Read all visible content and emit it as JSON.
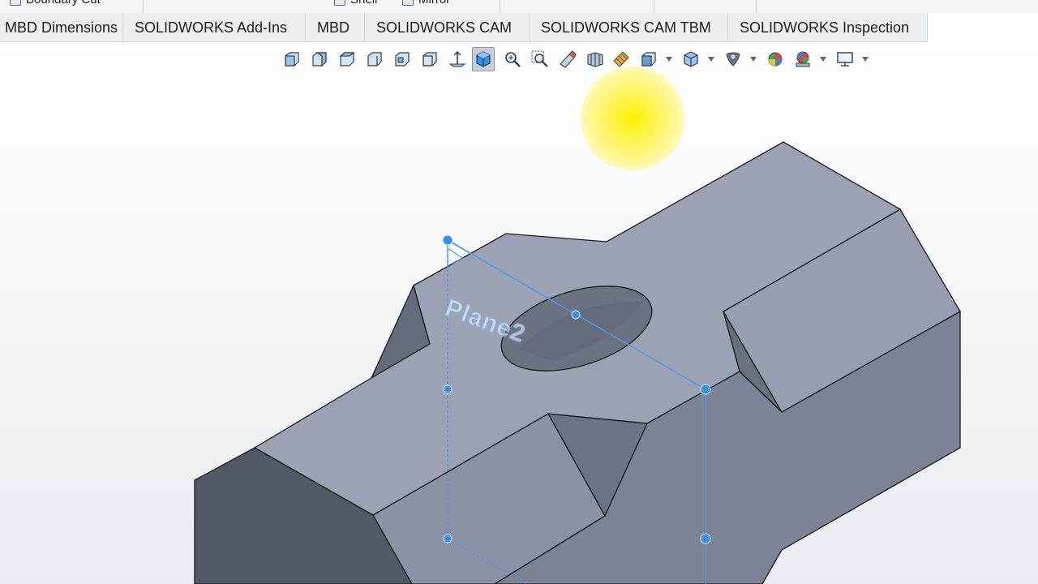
{
  "ribbon": {
    "items": [
      "Boundary Cut",
      "Shell",
      "Mirror"
    ]
  },
  "tabs": [
    {
      "label": "MBD Dimensions"
    },
    {
      "label": "SOLIDWORKS Add-Ins"
    },
    {
      "label": "MBD"
    },
    {
      "label": "SOLIDWORKS CAM"
    },
    {
      "label": "SOLIDWORKS CAM TBM"
    },
    {
      "label": "SOLIDWORKS Inspection"
    }
  ],
  "viewport": {
    "plane_label": "Plane2"
  },
  "colors": {
    "accent": "#3b8fe0",
    "part_top": "#9aa0b1",
    "part_side": "#7b8193",
    "part_dark": "#555a67",
    "highlight": "#fff200"
  },
  "toolbar_icons": [
    "front-view-icon",
    "back-view-icon",
    "left-view-icon",
    "right-view-icon",
    "top-view-icon",
    "bottom-view-icon",
    "normal-to-icon",
    "isometric-view-icon",
    "zoom-to-fit-icon",
    "zoom-to-area-icon",
    "previous-view-icon",
    "section-view-icon",
    "dynamic-annotation-icon",
    "view-orientation-icon",
    "display-style-icon",
    "hide-show-icon",
    "edit-appearance-icon",
    "apply-scene-icon",
    "view-settings-icon"
  ]
}
